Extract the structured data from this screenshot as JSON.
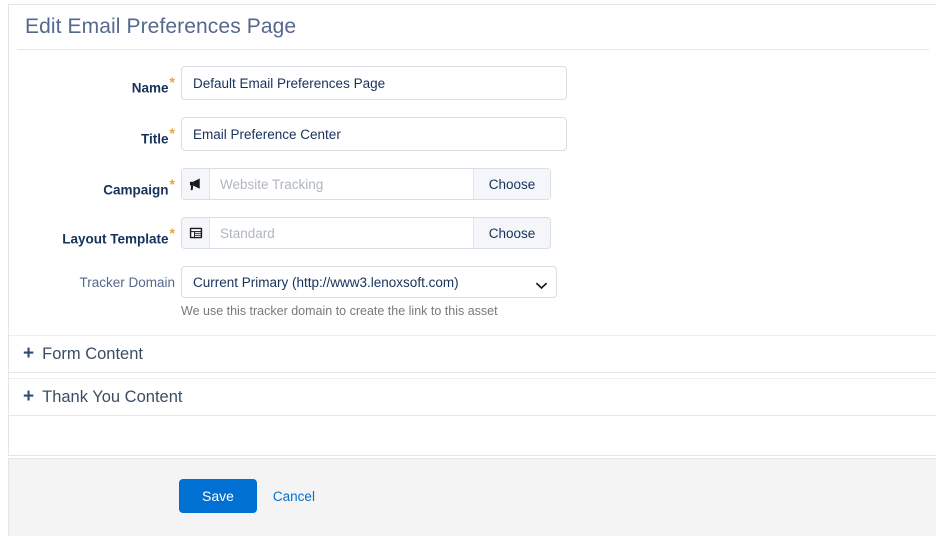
{
  "header": {
    "title": "Edit Email Preferences Page"
  },
  "form": {
    "fields": [
      {
        "label": "Name",
        "required": true,
        "type": "text",
        "value": "Default Email Preferences Page",
        "placeholder": ""
      },
      {
        "label": "Title",
        "required": true,
        "type": "text",
        "value": "Email Preference Center",
        "placeholder": ""
      },
      {
        "label": "Campaign",
        "required": true,
        "type": "lookup",
        "icon": "megaphone-icon",
        "value": "",
        "placeholder": "Website Tracking",
        "button_label": "Choose"
      },
      {
        "label": "Layout Template",
        "required": true,
        "type": "lookup",
        "icon": "layout-template-icon",
        "value": "",
        "placeholder": "Standard",
        "button_label": "Choose"
      },
      {
        "label": "Tracker Domain",
        "required": false,
        "type": "select",
        "value": "Current Primary (http://www3.lenoxsoft.com)",
        "options": [
          "Current Primary (http://www3.lenoxsoft.com)"
        ],
        "help_text": "We use this tracker domain to create the link to this asset"
      }
    ]
  },
  "accordions": [
    {
      "label": "Form Content",
      "expand_icon": "plus-icon"
    },
    {
      "label": "Thank You Content",
      "expand_icon": "plus-icon"
    }
  ],
  "footer": {
    "save_label": "Save",
    "cancel_label": "Cancel"
  },
  "colors": {
    "primary": "#0070d2",
    "required_asterisk": "#e8a33d",
    "title": "#54698d",
    "label": "#16325c",
    "accordion_label": "#3b4d64",
    "footer_bg": "#f4f4f4"
  }
}
